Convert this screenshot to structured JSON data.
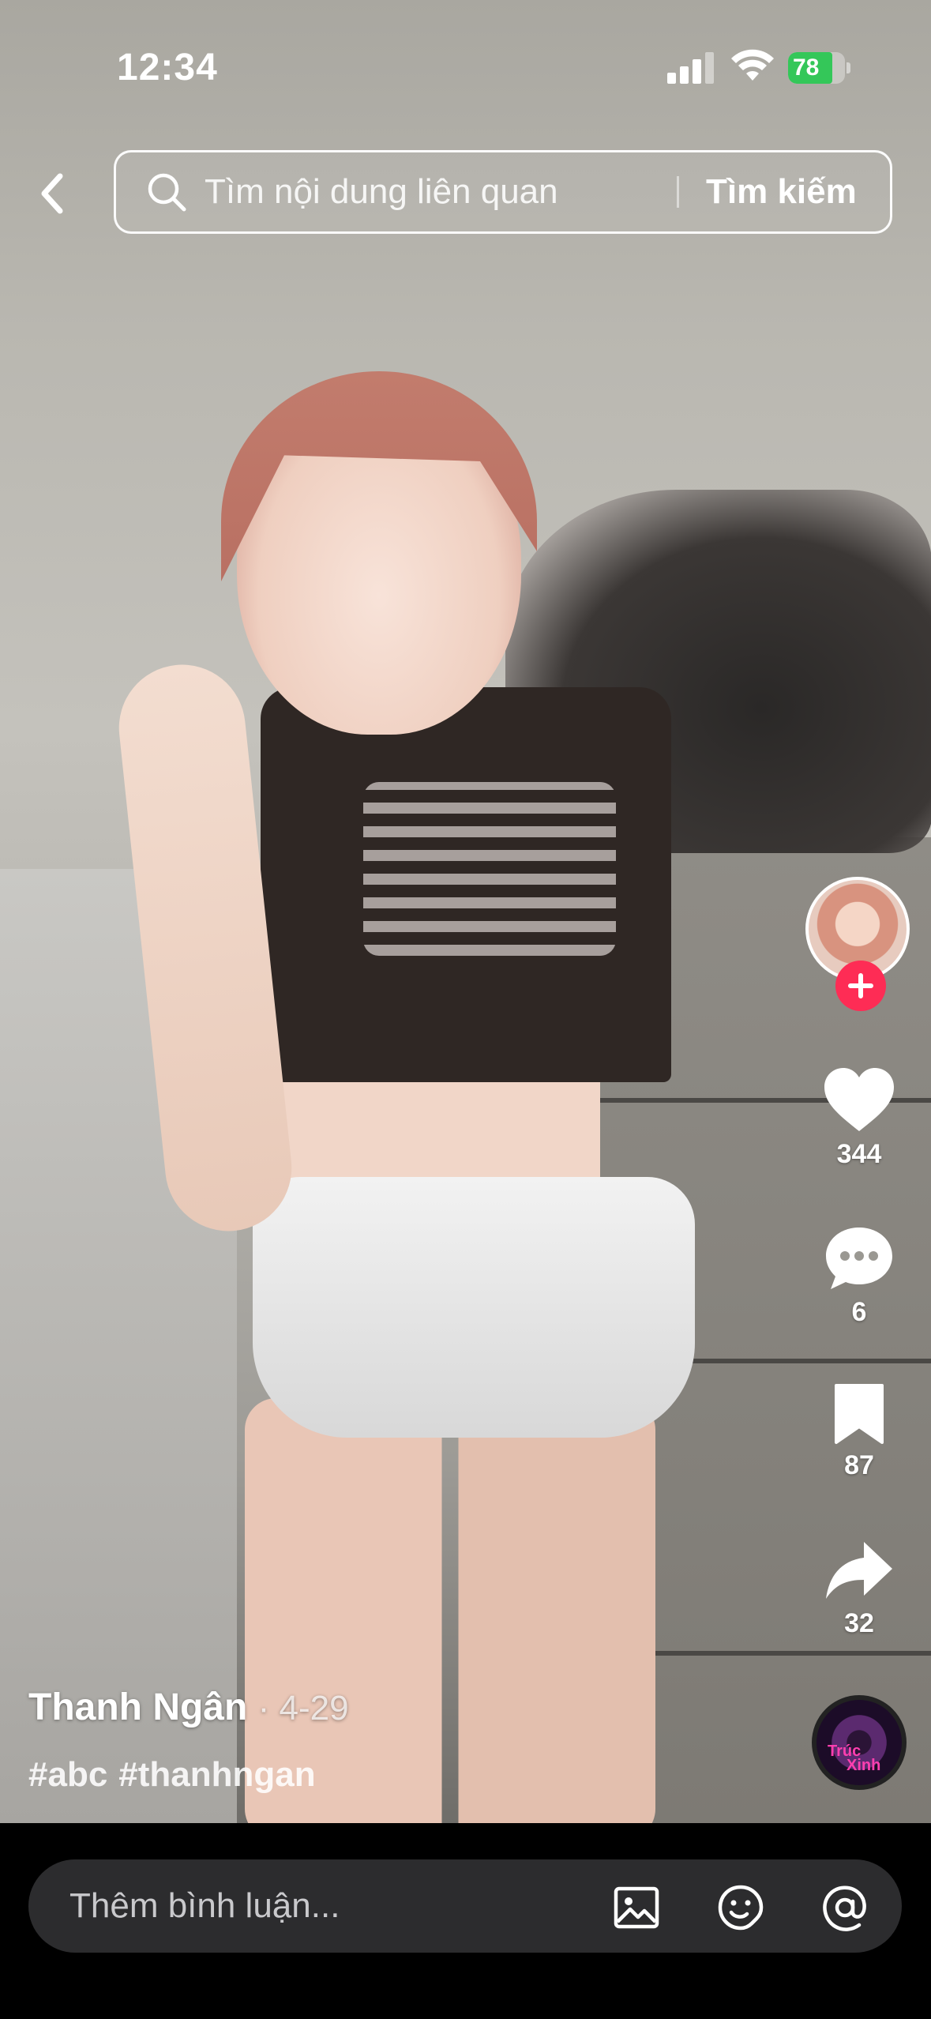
{
  "status_bar": {
    "time": "12:34",
    "battery_percent": "78",
    "battery_level": 0.78,
    "battery_color": "#34c759"
  },
  "search": {
    "placeholder": "Tìm nội dung liên quan",
    "submit_label": "Tìm kiếm"
  },
  "actions": {
    "likes": "344",
    "comments": "6",
    "saves": "87",
    "shares": "32"
  },
  "post": {
    "author": "Thanh Ngân",
    "date": "· 4-29",
    "hashtags": [
      "#abc",
      "#thanhngan"
    ]
  },
  "music_disc": {
    "label_line1": "Trúc",
    "label_line2": "Xinh"
  },
  "comment": {
    "placeholder": "Thêm bình luận..."
  },
  "icons": {
    "back": "chevron-left-icon",
    "search": "search-icon",
    "like": "heart-icon",
    "comment": "comment-bubble-icon",
    "save": "bookmark-icon",
    "share": "share-arrow-icon",
    "image": "image-icon",
    "emoji": "emoji-icon",
    "mention": "at-mention-icon"
  },
  "colors": {
    "follow": "#fe2c55",
    "comment_bar_bg": "#2c2c2e"
  }
}
